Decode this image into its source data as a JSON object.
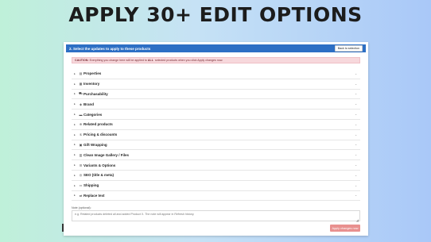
{
  "headline": "APPLY 30+ EDIT OPTIONS",
  "panel": {
    "title": "2. Select the updates to apply to these products",
    "back_label": "Back to selection"
  },
  "caution": {
    "prefix": "CAUTION:",
    "text_before": "Everything you change here will be applied to",
    "emphasis": "ALL",
    "text_after": "selected products when you click Apply changes now."
  },
  "sections": [
    {
      "label": "Properties",
      "icon": "document-icon"
    },
    {
      "label": "Inventory",
      "icon": "box-icon"
    },
    {
      "label": "Purchasability",
      "icon": "cart-icon"
    },
    {
      "label": "Brand",
      "icon": "tag-icon"
    },
    {
      "label": "Categories",
      "icon": "folder-icon"
    },
    {
      "label": "Related products",
      "icon": "link-icon"
    },
    {
      "label": "Pricing & discounts",
      "icon": "dollar-icon"
    },
    {
      "label": "Gift Wrapping",
      "icon": "gift-icon"
    },
    {
      "label": "Clean Image Gallery / Files",
      "icon": "trash-icon"
    },
    {
      "label": "Variants & Options",
      "icon": "list-icon"
    },
    {
      "label": "SEO (title & meta)",
      "icon": "globe-icon"
    },
    {
      "label": "Shipping",
      "icon": "truck-icon"
    },
    {
      "label": "Replace text",
      "icon": "replace-icon"
    }
  ],
  "notes": {
    "label": "Note (optional):",
    "placeholder": "e.g. Related products deleted all and added Product X. The note will appear in Refresh history."
  },
  "apply_label": "Apply changes now"
}
